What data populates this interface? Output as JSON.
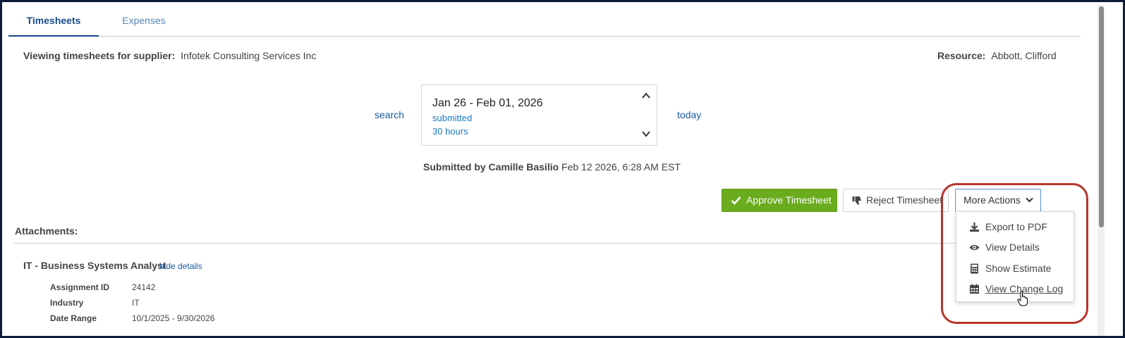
{
  "tabs": [
    {
      "label": "Timesheets",
      "active": true
    },
    {
      "label": "Expenses",
      "active": false
    }
  ],
  "header": {
    "supplier_label": "Viewing timesheets for supplier:",
    "supplier_value": "Infotek Consulting Services Inc",
    "resource_label": "Resource:",
    "resource_value": "Abbott, Clifford"
  },
  "period": {
    "search_link": "search",
    "today_link": "today",
    "range": "Jan 26 - Feb 01, 2026",
    "status": "submitted",
    "hours": "30 hours",
    "prev_icon": "chevron-up-icon",
    "next_icon": "chevron-down-icon"
  },
  "submission": {
    "by_label": "Submitted by Camille Basilio",
    "timestamp": "Feb 12 2026, 6:28 AM EST"
  },
  "actions": {
    "approve_label": "Approve Timesheet",
    "reject_label": "Reject Timesheet",
    "more_label": "More Actions",
    "approve_color": "#6aac1e"
  },
  "attachments_label": "Attachments:",
  "assignment": {
    "title": "IT - Business Systems Analyst",
    "toggle_link": "hide details",
    "details": [
      {
        "label": "Assignment ID",
        "value": "24142"
      },
      {
        "label": "Industry",
        "value": "IT"
      },
      {
        "label": "Date Range",
        "value": "10/1/2025 - 9/30/2026"
      }
    ]
  },
  "more_actions_menu": {
    "items": [
      {
        "label": "Export to PDF",
        "icon": "download-icon"
      },
      {
        "label": "View Details",
        "icon": "eye-icon"
      },
      {
        "label": "Show Estimate",
        "icon": "calculator-icon"
      },
      {
        "label": "View Change Log",
        "icon": "calendar-icon",
        "hovered": true
      }
    ]
  },
  "colors": {
    "link": "#1b5aa2",
    "accent": "#1a4a8a",
    "annotation": "#b8352c"
  }
}
